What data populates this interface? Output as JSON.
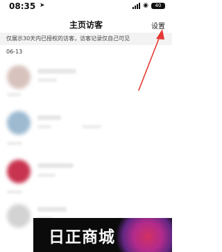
{
  "status_bar": {
    "time": "08:35",
    "battery": "40"
  },
  "nav": {
    "title": "主页访客",
    "settings_label": "设置"
  },
  "notice": {
    "text": "仅展示30天内已授权的访客，访客记录仅自己可见"
  },
  "date_header": "06-13",
  "visitors": [
    {
      "avatar_color": "#d8c2bd"
    },
    {
      "avatar_color": "#9dbad1"
    },
    {
      "avatar_color": "#c8344f"
    },
    {
      "avatar_color": "#d3d3d3"
    }
  ],
  "watermark": {
    "text": "日正商城"
  },
  "colors": {
    "arrow": "#e53935",
    "notice_bg": "#f3f3f3"
  }
}
